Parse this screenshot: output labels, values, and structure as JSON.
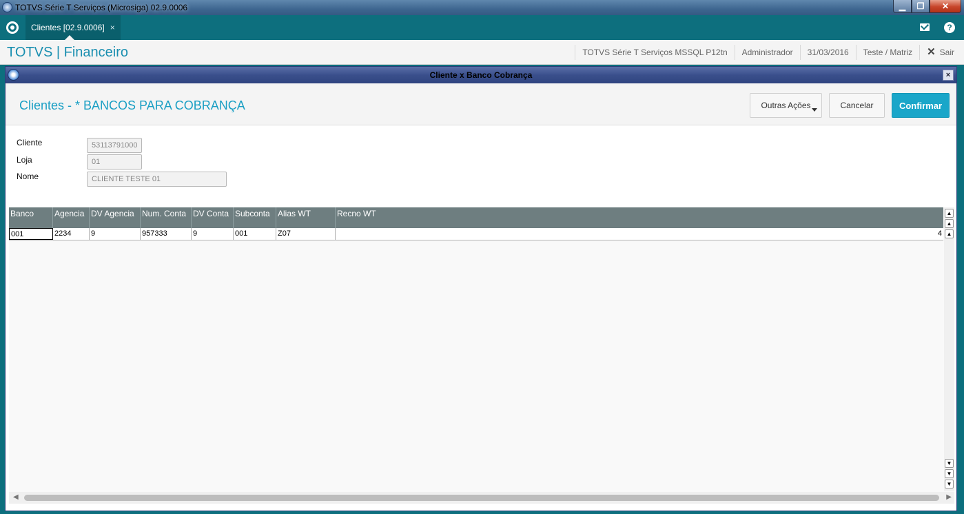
{
  "window": {
    "title": "TOTVS Série T Serviços (Microsiga) 02.9.0006"
  },
  "tabbar": {
    "tab_label": "Clientes [02.9.0006]",
    "tab_close": "×"
  },
  "header": {
    "module_title": "TOTVS | Financeiro",
    "environment": "TOTVS Série T Serviços MSSQL P12tn",
    "user": "Administrador",
    "date": "31/03/2016",
    "company": "Teste / Matriz",
    "exit_label": "Sair"
  },
  "dialog": {
    "title": "Cliente x Banco Cobrança",
    "form_title": "Clientes - * BANCOS PARA COBRANÇA",
    "buttons": {
      "other_actions": "Outras Ações",
      "cancel": "Cancelar",
      "confirm": "Confirmar"
    },
    "fields": {
      "cliente_label": "Cliente",
      "cliente_value": "53113791000",
      "loja_label": "Loja",
      "loja_value": "01",
      "nome_label": "Nome",
      "nome_value": "CLIENTE TESTE 01"
    }
  },
  "grid": {
    "columns": [
      "Banco",
      "Agencia",
      "DV Agencia",
      "Num. Conta",
      "DV Conta",
      "Subconta",
      "Alias WT",
      "Recno WT"
    ],
    "rows": [
      [
        "001",
        "2234",
        "9",
        "957333",
        "9",
        "001",
        "Z07",
        "4"
      ]
    ]
  },
  "colors": {
    "brand_teal": "#0d6f7e",
    "accent_blue": "#1aa6c9",
    "grid_header": "#6e7e80",
    "dialog_title": "#3a4f8c"
  }
}
